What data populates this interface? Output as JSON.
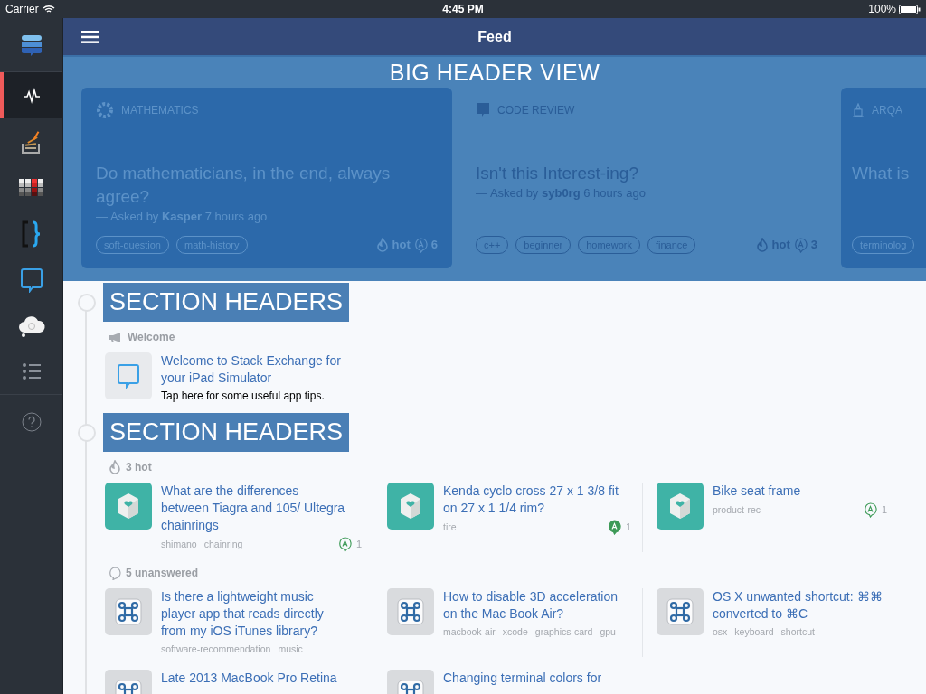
{
  "status_bar": {
    "carrier": "Carrier",
    "time": "4:45 PM",
    "battery": "100%"
  },
  "sidebar": {
    "items": [
      {
        "kind": "logo",
        "selected": false
      },
      {
        "kind": "activity",
        "selected": true
      },
      {
        "kind": "stack",
        "selected": false
      },
      {
        "kind": "grid",
        "selected": false
      },
      {
        "kind": "brackets",
        "selected": false
      },
      {
        "kind": "chat",
        "selected": false
      },
      {
        "kind": "cloud",
        "selected": false
      },
      {
        "kind": "list",
        "selected": false
      },
      {
        "kind": "help",
        "selected": false
      }
    ]
  },
  "nav": {
    "title": "Feed"
  },
  "header": {
    "overlay": "BIG HEADER VIEW",
    "cards": [
      {
        "kind": "gear",
        "shaded": true,
        "site": "MATHEMATICS",
        "title": "Do mathematicians, in the end, always agree?",
        "byline": "— Asked by **Kasper** 7 hours ago",
        "tags": [
          "soft-question",
          "math-history"
        ],
        "hot": "hot",
        "answers": "6"
      },
      {
        "kind": "code",
        "shaded": false,
        "site": "CODE REVIEW",
        "title": "Isn't this Interest-ing?",
        "byline": "— Asked by **syb0rg** 6 hours ago",
        "tags": [
          "c++",
          "beginner",
          "homework",
          "finance"
        ],
        "hot": "hot",
        "answers": "3"
      },
      {
        "kind": "building",
        "shaded": true,
        "site": "ARQA",
        "title": "What is",
        "tags": [
          "terminolog"
        ]
      }
    ]
  },
  "feed": [
    {
      "kind": "section_header",
      "text": "SECTION HEADERS"
    },
    {
      "kind": "welcome",
      "label": "Welcome",
      "items": [
        {
          "title": "Welcome to Stack Exchange for your iPad Simulator",
          "subtitle": "Tap here for some useful app tips."
        }
      ]
    },
    {
      "kind": "section_header",
      "text": "SECTION HEADERS"
    },
    {
      "kind": "hot",
      "label": "3 hot",
      "items": [
        {
          "title": "What are the differences between Tiagra and 105/ Ultegra chainrings",
          "tags": [
            "shimano",
            "chainring"
          ],
          "answers": "1",
          "accepted": false
        },
        {
          "title": "Kenda cyclo cross 27 x 1 3/8 fit on 27 x 1 1/4 rim?",
          "tags": [
            "tire"
          ],
          "answers": "1",
          "accepted": true
        },
        {
          "title": "Bike seat frame",
          "tags": [
            "product-rec"
          ],
          "answers": "1",
          "accepted": false
        }
      ]
    },
    {
      "kind": "unanswered",
      "label": "5 unanswered",
      "items": [
        {
          "title": "Is there a lightweight music player app that reads directly from my iOS iTunes library?",
          "tags": [
            "software-recommendation",
            "music"
          ]
        },
        {
          "title": "How to disable 3D acceleration on the Mac Book Air?",
          "tags": [
            "macbook-air",
            "xcode",
            "graphics-card",
            "gpu"
          ]
        },
        {
          "title": "OS X unwanted shortcut: ⌘⌘ converted to ⌘C",
          "tags": [
            "osx",
            "keyboard",
            "shortcut"
          ]
        },
        {
          "title": "Late 2013 MacBook Pro Retina"
        },
        {
          "title": "Changing terminal colors for"
        }
      ]
    }
  ]
}
